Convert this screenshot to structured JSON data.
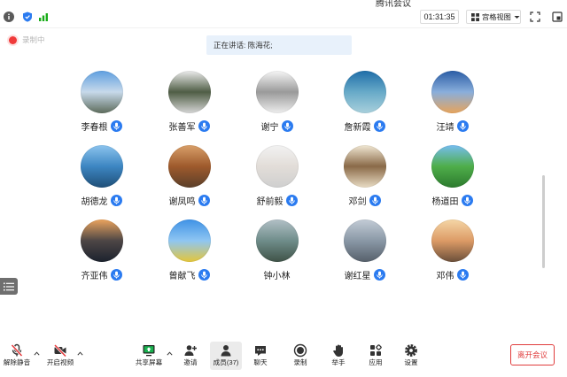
{
  "window": {
    "title": "腾讯会议"
  },
  "topbar": {
    "timer": "01:31:35",
    "view_mode_label": "宫格视图",
    "icons": [
      "info-icon",
      "shield-icon",
      "signal-icon",
      "grid-view-icon",
      "chevron-down-icon",
      "fullscreen-icon",
      "pop-out-icon"
    ]
  },
  "recording": {
    "label": "录制中"
  },
  "speaking_banner": {
    "text": "正在讲话: 陈海花;"
  },
  "participants": [
    {
      "name": "李春根",
      "mic_icon": true,
      "avatar_colors": [
        "#5e9fe0",
        "#c7d9ea",
        "#5d6c5c"
      ]
    },
    {
      "name": "张善军",
      "mic_icon": true,
      "avatar_colors": [
        "#ececec",
        "#4f5d45",
        "#d6d6d6"
      ]
    },
    {
      "name": "谢宁",
      "mic_icon": true,
      "avatar_colors": [
        "#f6f6f6",
        "#9a9a9a",
        "#eeeeee"
      ]
    },
    {
      "name": "詹新霞",
      "mic_icon": true,
      "avatar_colors": [
        "#1f6ea8",
        "#68aac8",
        "#a9d0dc"
      ]
    },
    {
      "name": "汪靖",
      "mic_icon": true,
      "avatar_colors": [
        "#2a5da6",
        "#89aedb",
        "#e7a45c"
      ]
    },
    {
      "name": "胡德龙",
      "mic_icon": true,
      "avatar_colors": [
        "#8cc4ee",
        "#3d86c2",
        "#1f4f78"
      ]
    },
    {
      "name": "谢凤鸣",
      "mic_icon": true,
      "avatar_colors": [
        "#d9a06a",
        "#9e5a2c",
        "#5b3f2a"
      ]
    },
    {
      "name": "舒前毅",
      "mic_icon": true,
      "avatar_colors": [
        "#f2f2f2",
        "#e2ddd8",
        "#cfcfcf"
      ]
    },
    {
      "name": "邓剑",
      "mic_icon": true,
      "avatar_colors": [
        "#f1e8d4",
        "#8a6a48",
        "#e9dcc4"
      ]
    },
    {
      "name": "杨道田",
      "mic_icon": true,
      "avatar_colors": [
        "#76bdf0",
        "#4fae4a",
        "#2c7a2e"
      ]
    },
    {
      "name": "齐亚伟",
      "mic_icon": true,
      "avatar_colors": [
        "#eba45e",
        "#4d4646",
        "#1c222e"
      ]
    },
    {
      "name": "曾献飞",
      "mic_icon": true,
      "avatar_colors": [
        "#3f92e6",
        "#8fc6f2",
        "#e4c63a"
      ]
    },
    {
      "name": "钟小林",
      "mic_icon": false,
      "avatar_colors": [
        "#b2c0c6",
        "#6f8d8a",
        "#3f5247"
      ]
    },
    {
      "name": "谢红星",
      "mic_icon": true,
      "avatar_colors": [
        "#c3ccd6",
        "#8a98a6",
        "#56606b"
      ]
    },
    {
      "name": "邓伟",
      "mic_icon": true,
      "avatar_colors": [
        "#f5d6a6",
        "#dd9b66",
        "#6b4f3a"
      ]
    }
  ],
  "side_panel_toggle": {
    "icon": "list-icon"
  },
  "toolbar": {
    "items": [
      {
        "label": "解除静音",
        "icon": "mic-muted-icon",
        "has_menu": true
      },
      {
        "label": "开启视频",
        "icon": "video-off-icon",
        "has_menu": true
      },
      {
        "label": "共享屏幕",
        "icon": "share-screen-icon",
        "has_menu": true
      },
      {
        "label": "邀请",
        "icon": "invite-icon",
        "has_menu": false
      },
      {
        "label": "成员(37)",
        "icon": "members-icon",
        "has_menu": false,
        "active": true
      },
      {
        "label": "聊天",
        "icon": "chat-icon",
        "has_menu": false
      },
      {
        "label": "录制",
        "icon": "record-icon",
        "has_menu": false
      },
      {
        "label": "举手",
        "icon": "raise-hand-icon",
        "has_menu": false
      },
      {
        "label": "应用",
        "icon": "apps-icon",
        "has_menu": false
      },
      {
        "label": "设置",
        "icon": "settings-icon",
        "has_menu": false
      }
    ],
    "leave_label": "离开会议"
  },
  "colors": {
    "accent": "#2b7bf0",
    "recording": "#f03a3a",
    "leave": "#e03c3c",
    "banner_bg": "#e8f1fb",
    "share_green": "#19b14f"
  }
}
